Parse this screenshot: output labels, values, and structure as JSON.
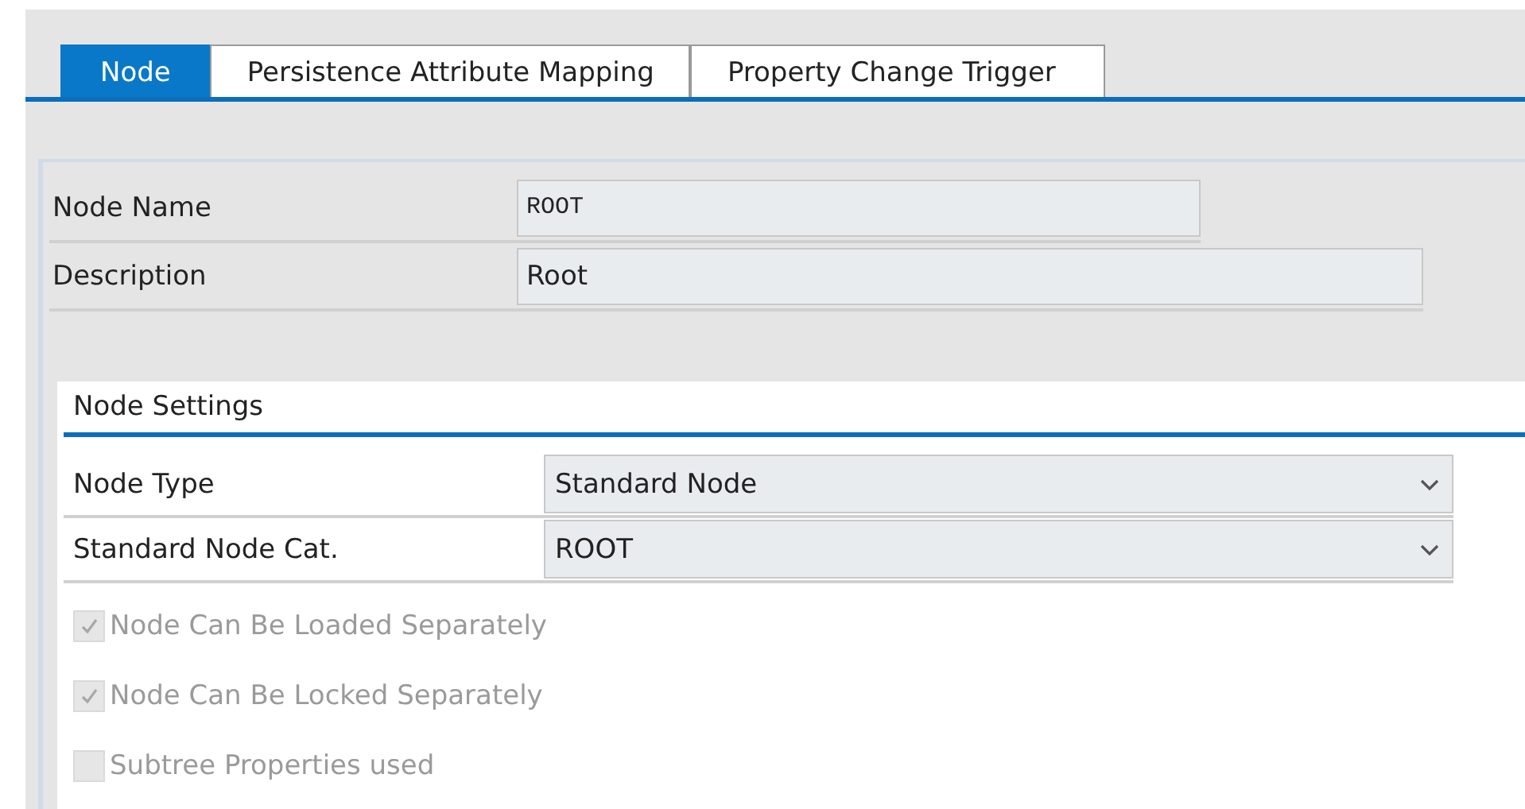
{
  "tabs": [
    {
      "label": "Node",
      "selected": true
    },
    {
      "label": "Persistence Attribute Mapping",
      "selected": false
    },
    {
      "label": "Property Change Trigger",
      "selected": false
    }
  ],
  "fields": [
    {
      "label": "Node Name",
      "value": "ROOT",
      "kind": "code"
    },
    {
      "label": "Description",
      "value": "Root",
      "kind": "text"
    }
  ],
  "node_settings": {
    "title": "Node Settings",
    "dropdowns": [
      {
        "label": "Node Type",
        "value": "Standard Node"
      },
      {
        "label": "Standard Node Cat.",
        "value": "ROOT"
      }
    ],
    "checkboxes": [
      {
        "label": "Node Can Be Loaded Separately",
        "checked": true,
        "disabled": true
      },
      {
        "label": "Node Can Be Locked Separately",
        "checked": true,
        "disabled": true
      },
      {
        "label": "Subtree Properties used",
        "checked": false,
        "disabled": true
      }
    ]
  }
}
